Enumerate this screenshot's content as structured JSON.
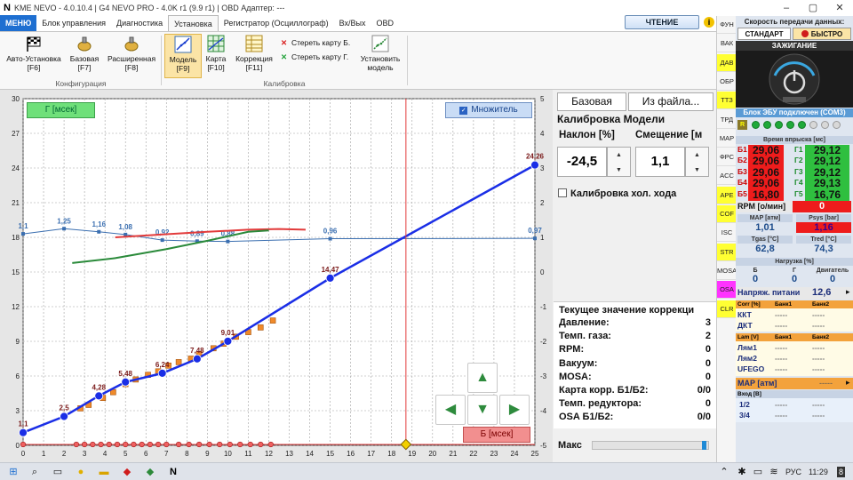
{
  "titlebar": {
    "text": "KME NEVO - 4.0.10.4  |  G4 NEVO PRO - 4.0K r1 (9.9 r1)  |  OBD Адаптер: ---",
    "logo": "N"
  },
  "menu": [
    {
      "name": "menu-main",
      "label": "МЕНЮ"
    },
    {
      "name": "menu-control-unit",
      "label": "Блок управления"
    },
    {
      "name": "menu-diagnostics",
      "label": "Диагностика"
    },
    {
      "name": "menu-setup",
      "label": "Установка"
    },
    {
      "name": "menu-recorder",
      "label": "Регистратор (Осциллограф)"
    },
    {
      "name": "menu-io",
      "label": "Вх/Вых"
    },
    {
      "name": "menu-obd",
      "label": "OBD"
    }
  ],
  "mode_button": "ЧТЕНИЕ",
  "help_icon": "i",
  "ribbon": {
    "auto_setup": "Авто-Установка",
    "auto_setup_key": "[F6]",
    "basic": "Базовая",
    "basic_key": "[F7]",
    "extended": "Расширенная",
    "extended_key": "[F8]",
    "model": "Модель",
    "model_key": "[F9]",
    "map": "Карта",
    "map_key": "[F10]",
    "correction": "Коррекция",
    "correction_key": "[F11]",
    "erase_b": "Стереть карту Б.",
    "erase_g": "Стереть карту Г.",
    "install_model_1": "Установить",
    "install_model_2": "модель",
    "group_config": "Конфигурация",
    "group_calibration": "Калибровка"
  },
  "chart_data": {
    "type": "scatter",
    "x_ticks": [
      "0",
      "1",
      "2",
      "3",
      "4",
      "5",
      "6",
      "7",
      "8",
      "9",
      "10",
      "11",
      "12",
      "13",
      "14",
      "15",
      "16",
      "17",
      "18",
      "19",
      "20",
      "21",
      "22",
      "23",
      "24",
      "25"
    ],
    "y_left_ticks": [
      "0",
      "3",
      "6",
      "9",
      "12",
      "15",
      "18",
      "21",
      "24",
      "27",
      "30"
    ],
    "y_right_ticks": [
      "-5",
      "-4",
      "-3",
      "-2",
      "-1",
      "0",
      "1",
      "2",
      "3",
      "4",
      "5"
    ],
    "xlim": [
      0,
      25
    ],
    "ylim": [
      0,
      30
    ],
    "y2lim": [
      -5,
      5
    ],
    "model_line": {
      "x": [
        0,
        2,
        3.7,
        5,
        6.8,
        8.5,
        10,
        15,
        25
      ],
      "y": [
        1.1,
        2.5,
        4.28,
        5.48,
        6.24,
        7.48,
        9.01,
        14.47,
        24.26
      ],
      "labels": [
        "1,1",
        "2,5",
        "4,28",
        "5,48",
        "6,24",
        "7,48",
        "9,01",
        "14,47",
        "24,26"
      ]
    },
    "multiplier_line": {
      "x": [
        0,
        2,
        3.7,
        5,
        6.8,
        8.5,
        10,
        15,
        25
      ],
      "y": [
        1.1,
        1.25,
        1.16,
        1.08,
        0.92,
        0.89,
        0.88,
        0.96,
        0.97
      ],
      "labels": [
        "1,1",
        "1,25",
        "1,16",
        "1,08",
        "0,92",
        "0,89",
        "0,88",
        "0,96",
        "0,97"
      ]
    },
    "b_points": {
      "x": [
        2.8,
        3.2,
        3.9,
        4.4,
        5.0,
        5.5,
        6.1,
        6.6,
        7.1,
        7.6,
        8.2,
        8.6,
        9.3,
        9.8,
        10.4,
        11.0,
        11.6,
        12.2
      ],
      "y": [
        3.2,
        3.5,
        4.1,
        4.6,
        5.3,
        5.7,
        6.1,
        6.4,
        6.9,
        7.2,
        7.5,
        7.9,
        8.4,
        8.8,
        9.4,
        9.8,
        10.2,
        10.8
      ]
    },
    "red_curve": {
      "x": [
        4.5,
        7,
        9,
        11,
        12.5,
        13.8
      ],
      "y": [
        1.0,
        1.09,
        1.16,
        1.22,
        1.24,
        1.22
      ]
    },
    "green_curve": {
      "x": [
        2.4,
        4.5,
        7,
        9,
        11,
        12
      ],
      "y": [
        0.26,
        0.4,
        0.66,
        0.9,
        1.16,
        1.2
      ]
    },
    "axis_marks": {
      "x": [
        0,
        2.6,
        3,
        3.4,
        3.8,
        4.2,
        4.6,
        5,
        5.4,
        5.8,
        6.2,
        6.6,
        7,
        7.6,
        8.1,
        8.6,
        9.1,
        9.6,
        10.1,
        10.6,
        11.1,
        11.6,
        12.1
      ]
    },
    "cursor": {
      "x": 18.7,
      "y": 0
    },
    "g_label": "Г [мсек]",
    "b_label": "Б [мсек]",
    "multiplier_label": "Множитель"
  },
  "arrows": {
    "up": "▲",
    "down": "▼",
    "left": "◀",
    "right": "▶"
  },
  "calibration": {
    "base_button": "Базовая",
    "from_file_button": "Из файла...",
    "title": "Калибровка Модели",
    "slope_label": "Наклон [%]",
    "offset_label": "Смещение [м",
    "slope_value": "-24,5",
    "offset_value": "1,1",
    "spin_up": "▲",
    "spin_down": "▼",
    "idle_label": "Калибровка хол. хода"
  },
  "status": {
    "title": "Текущее значение коррекци",
    "rows": [
      {
        "label": "Давление:",
        "value": "3"
      },
      {
        "label": "Темп. газа:",
        "value": "2"
      },
      {
        "label": "RPM:",
        "value": "0"
      },
      {
        "label": "Вакуум:",
        "value": "0"
      },
      {
        "label": "MOSA:",
        "value": "0"
      },
      {
        "label": "Карта корр. Б1/Б2:",
        "value": "0/0"
      },
      {
        "label": "Темп. редуктора:",
        "value": "0"
      },
      {
        "label": "OSA Б1/Б2:",
        "value": "0/0"
      }
    ],
    "max_label": "Макс"
  },
  "side_tabs": [
    {
      "label": "ФУН",
      "color": "#f5f5f5"
    },
    {
      "label": "ВАК",
      "color": "#f5f5f5"
    },
    {
      "label": "ДАВ",
      "color": "#ffff33"
    },
    {
      "label": "ОБР",
      "color": "#f5f5f5"
    },
    {
      "label": "ТТЗ",
      "color": "#ffff33"
    },
    {
      "label": "ТРД",
      "color": "#f5f5f5"
    },
    {
      "label": "MAP",
      "color": "#f5f5f5"
    },
    {
      "label": "ФРС",
      "color": "#f5f5f5"
    },
    {
      "label": "ACC",
      "color": "#f5f5f5"
    },
    {
      "label": "APE",
      "color": "#ffff33"
    },
    {
      "label": "COF",
      "color": "#ffff33"
    },
    {
      "label": "ISC",
      "color": "#f5f5f5"
    },
    {
      "label": "STR",
      "color": "#ffff33"
    },
    {
      "label": "MOSA",
      "color": "#f5f5f5"
    },
    {
      "label": "OSA",
      "color": "#ff33ff"
    },
    {
      "label": "CLR",
      "color": "#ffff33"
    }
  ],
  "right_panel": {
    "speed_title": "Скорость передачи данных:",
    "standard": "СТАНДАРТ",
    "fast": "БЫСТРО",
    "ignition": "ЗАЖИГАНИЕ",
    "ecu_status": "Блок ЭБУ подключен (COM3)",
    "led_label": "R",
    "injection_title": "Время впрыска [мс]",
    "injectors": [
      {
        "b": "Б1",
        "bv": "29,06",
        "g": "Г1",
        "gv": "29,12"
      },
      {
        "b": "Б2",
        "bv": "29,06",
        "g": "Г2",
        "gv": "29,12"
      },
      {
        "b": "Б3",
        "bv": "29,06",
        "g": "Г3",
        "gv": "29,12"
      },
      {
        "b": "Б4",
        "bv": "29,06",
        "g": "Г4",
        "gv": "29,13"
      },
      {
        "b": "Б5",
        "bv": "16,80",
        "g": "Г5",
        "gv": "16,76"
      }
    ],
    "rpm_label": "RPM [о/мин]",
    "rpm_value": "0",
    "map_label": "MAP [атм]",
    "map_value": "1,01",
    "psys_label": "Psys [bar]",
    "psys_value": "1,16",
    "tgas_label": "Tgas [°C]",
    "tgas_value": "62,8",
    "tred_label": "Tred [°C]",
    "tred_value": "74,3",
    "load_title": "Нагрузка [%]",
    "load_b": "Б",
    "load_g": "Г",
    "load_engine": "Двигатель",
    "load_b_value": "0",
    "load_g_value": "0",
    "load_engine_value": "0",
    "voltage_label": "Напряж. питани",
    "voltage_value": "12,6",
    "corr_title": "Corr [%]",
    "bank1": "Банк1",
    "bank2": "Банк2",
    "kkt": "ККТ",
    "dkt": "ДКТ",
    "dash": "-----",
    "lam_title": "Lam [V]",
    "lam1": "Лям1",
    "lam2": "Лям2",
    "ufego": "UFEGO",
    "map_atm": "MAP [атм]",
    "input_title": "Вход [В]",
    "input_1": "1/2",
    "input_2": "3/4"
  },
  "taskbar": {
    "lang": "РУС",
    "time": "11:29",
    "notif": "8"
  }
}
